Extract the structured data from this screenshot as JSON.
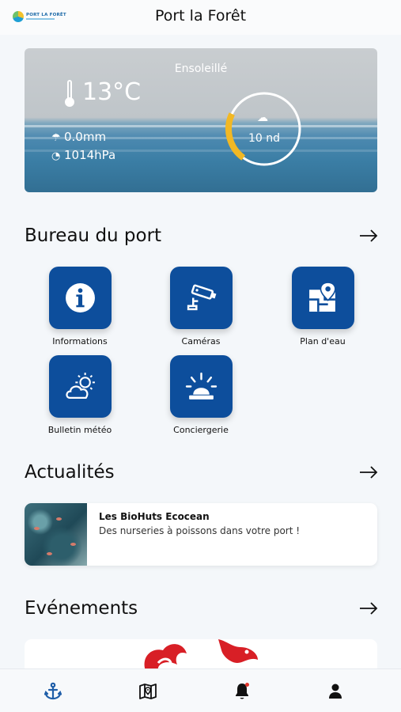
{
  "app": {
    "title": "Port la Forêt",
    "logo_text": "PORT LA FORÊT"
  },
  "weather": {
    "condition": "Ensoleillé",
    "temperature": "13°C",
    "rain": "0.0mm",
    "pressure": "1014hPa",
    "wind": "10 nd",
    "wind_gauge_fraction": 0.22,
    "gauge_color": "#f2b824"
  },
  "sections": {
    "bureau": {
      "title": "Bureau du port"
    },
    "news": {
      "title": "Actualités"
    },
    "events": {
      "title": "Evénements"
    }
  },
  "tiles": [
    {
      "label": "Informations",
      "icon": "info-icon"
    },
    {
      "label": "Caméras",
      "icon": "camera-icon"
    },
    {
      "label": "Plan d'eau",
      "icon": "map-pin-icon"
    },
    {
      "label": "Bulletin météo",
      "icon": "weather-icon"
    },
    {
      "label": "Conciergerie",
      "icon": "alarm-light-icon"
    }
  ],
  "news": [
    {
      "title": "Les BioHuts Ecocean",
      "subtitle": "Des nurseries à poissons dans votre port !"
    }
  ],
  "nav": [
    {
      "name": "anchor-icon",
      "active": true
    },
    {
      "name": "map-icon",
      "active": false
    },
    {
      "name": "bell-icon",
      "active": false
    },
    {
      "name": "user-icon",
      "active": false
    }
  ],
  "colors": {
    "primary": "#0d4e9c",
    "background": "#f4f7fa",
    "active_nav": "#1f5ea8",
    "alert_dot": "#e0342b"
  }
}
